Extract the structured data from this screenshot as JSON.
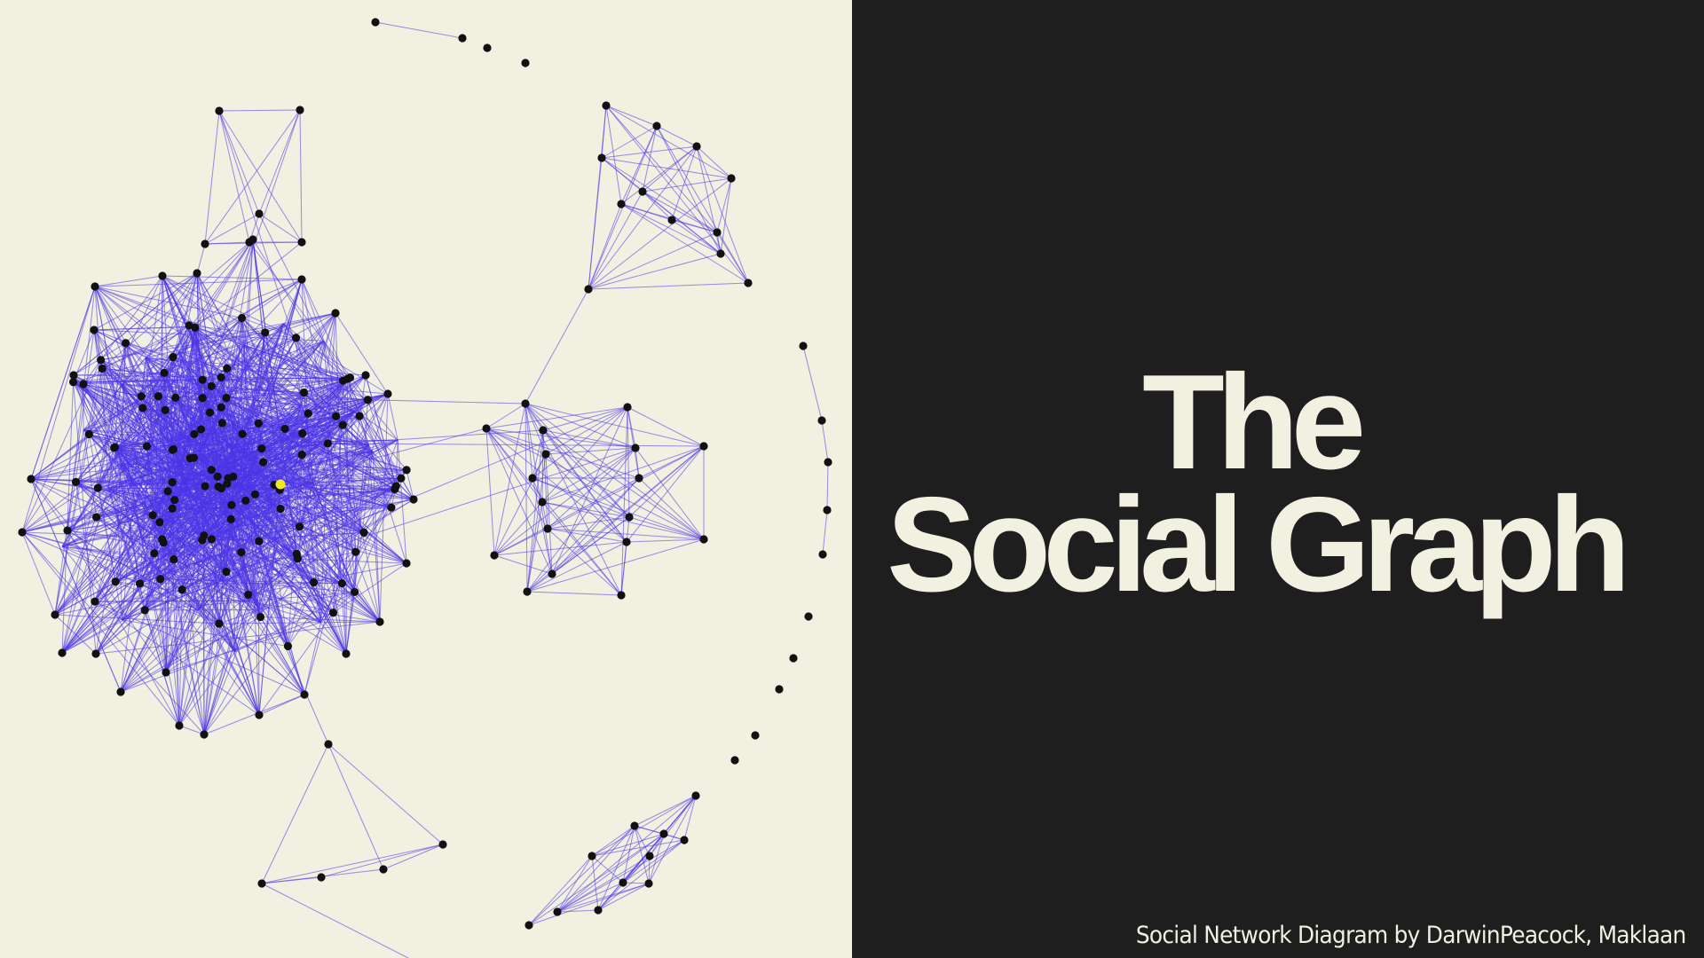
{
  "title": {
    "line1": "The",
    "line2": "Social Graph"
  },
  "caption": "Social Network Diagram by DarwinPeacock, Maklaan",
  "colors": {
    "left_background": "#f1f0e1",
    "right_background": "#1e1e1e",
    "edge": "#4a35e8",
    "node": "#111111",
    "highlight_node": "#f4ea1b",
    "title_text": "#f1f0e1"
  }
}
